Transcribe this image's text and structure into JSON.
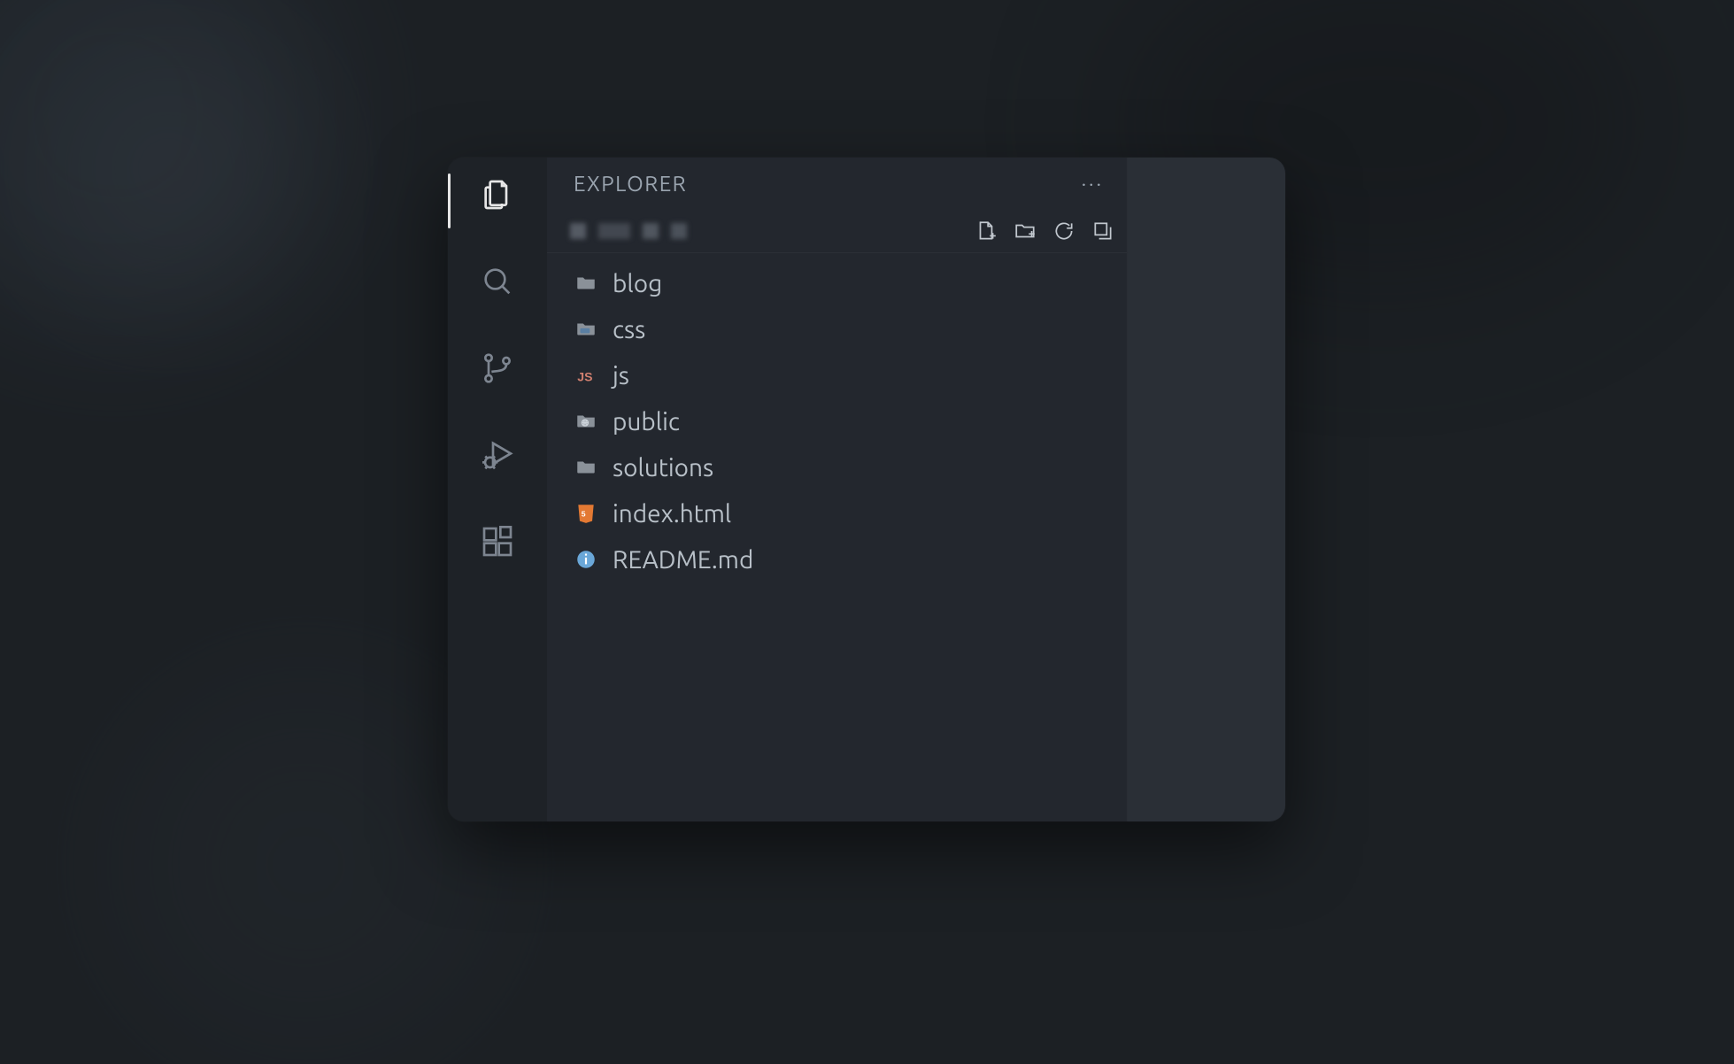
{
  "sidebar": {
    "title": "EXPLORER",
    "more_label": "···"
  },
  "activity": {
    "items": [
      {
        "name": "explorer",
        "active": true
      },
      {
        "name": "search",
        "active": false
      },
      {
        "name": "source-control",
        "active": false
      },
      {
        "name": "run-debug",
        "active": false
      },
      {
        "name": "extensions",
        "active": false
      }
    ]
  },
  "section_actions": {
    "new_file": "New File",
    "new_folder": "New Folder",
    "refresh": "Refresh",
    "collapse": "Collapse All"
  },
  "tree": {
    "items": [
      {
        "label": "blog",
        "kind": "folder",
        "icon": "folder"
      },
      {
        "label": "css",
        "kind": "folder",
        "icon": "css"
      },
      {
        "label": "js",
        "kind": "folder",
        "icon": "js"
      },
      {
        "label": "public",
        "kind": "folder",
        "icon": "globe"
      },
      {
        "label": "solutions",
        "kind": "folder",
        "icon": "folder"
      },
      {
        "label": "index.html",
        "kind": "file",
        "icon": "html"
      },
      {
        "label": "README.md",
        "kind": "file",
        "icon": "info"
      }
    ]
  },
  "colors": {
    "bg": "#1c2024",
    "panel": "#23272e",
    "editor": "#2a2f36",
    "text_muted": "#9aa4af",
    "text": "#b8c0c8",
    "icon_html": "#e37933",
    "icon_info": "#6aa7d8",
    "icon_js": "#d07f6f",
    "icon_css": "#6aa7d8"
  }
}
